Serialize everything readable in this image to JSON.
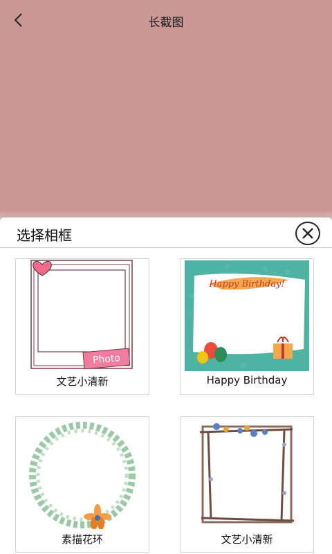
{
  "header": {
    "title": "长截图",
    "back_icon": "chevron-left-icon"
  },
  "colors": {
    "preview_bg": "#c89796",
    "birthday_bg": "#4fb3a3"
  },
  "sheet": {
    "title": "选择相框",
    "close_icon": "close-icon"
  },
  "frames": [
    {
      "label": "文艺小清新",
      "thumb_text": "Photo"
    },
    {
      "label": "Happy Birthday",
      "thumb_text": "Happy Birthday!"
    },
    {
      "label": "素描花环"
    },
    {
      "label": "文艺小清新"
    }
  ]
}
